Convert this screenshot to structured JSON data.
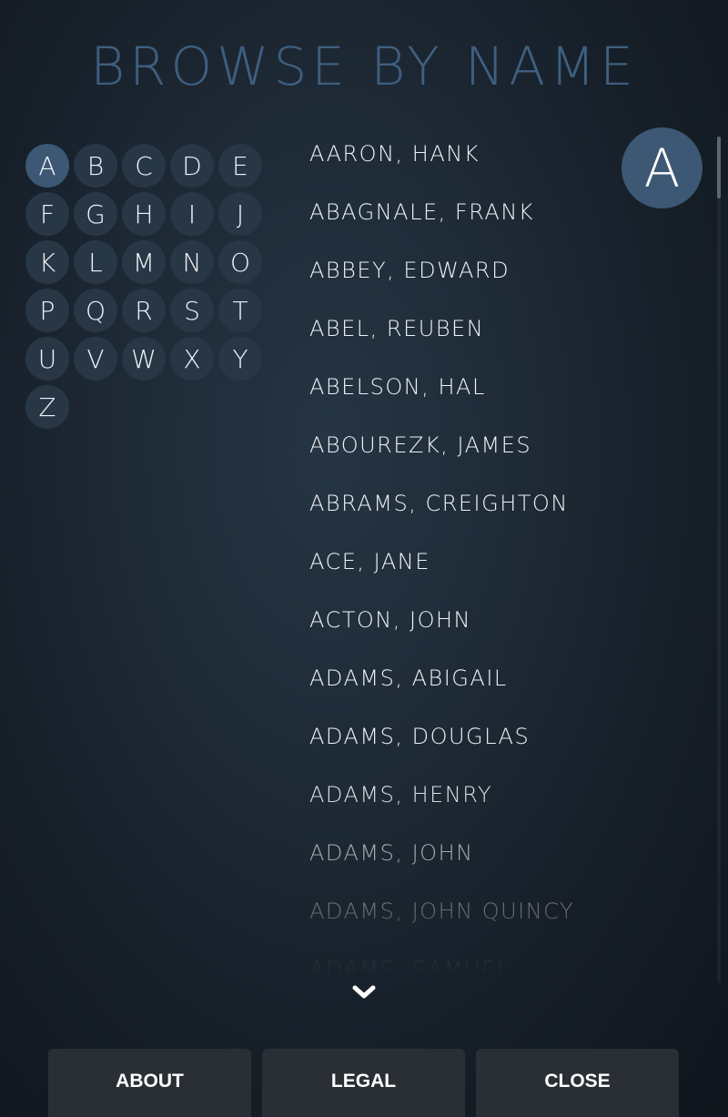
{
  "title": "BROWSE BY NAME",
  "alphabet": {
    "letters": [
      "A",
      "B",
      "C",
      "D",
      "E",
      "F",
      "G",
      "H",
      "I",
      "J",
      "K",
      "L",
      "M",
      "N",
      "O",
      "P",
      "Q",
      "R",
      "S",
      "T",
      "U",
      "V",
      "W",
      "X",
      "Y",
      "Z"
    ],
    "selected": "A"
  },
  "current_letter": "A",
  "names": [
    "AARON, HANK",
    "ABAGNALE, FRANK",
    "ABBEY, EDWARD",
    "ABEL, REUBEN",
    "ABELSON, HAL",
    "ABOUREZK, JAMES",
    "ABRAMS, CREIGHTON",
    "ACE, JANE",
    "ACTON, JOHN",
    "ADAMS, ABIGAIL",
    "ADAMS, DOUGLAS",
    "ADAMS, HENRY",
    "ADAMS, JOHN",
    "ADAMS, JOHN QUINCY",
    "ADAMS, SAMUEL"
  ],
  "scroll": {
    "icon": "chevron-down-icon"
  },
  "footer": {
    "about_label": "ABOUT",
    "legal_label": "LEGAL",
    "close_label": "CLOSE"
  },
  "colors": {
    "title": "#3e5f80",
    "accent": "#3c5874",
    "letter_bg": "#283746",
    "button_bg": "#2a2f35"
  }
}
